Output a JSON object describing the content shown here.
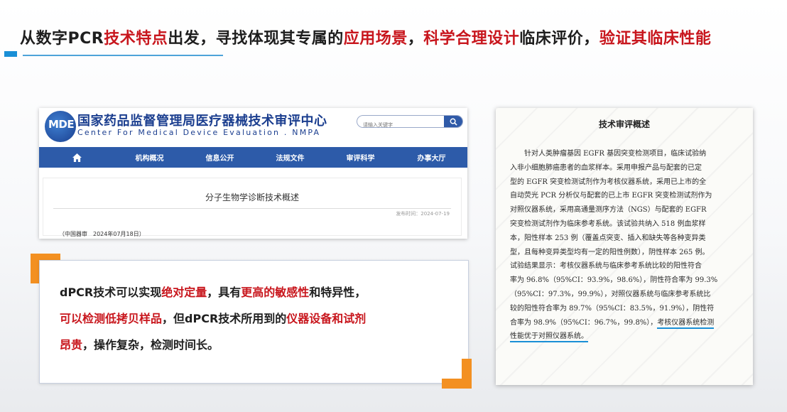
{
  "headline": {
    "segments": [
      {
        "text": "从数字PCR",
        "emph": false
      },
      {
        "text": "技术特点",
        "emph": true
      },
      {
        "text": "出发，寻找体现其专属的",
        "emph": false
      },
      {
        "text": "应用场景",
        "emph": true
      },
      {
        "text": "，",
        "emph": false
      },
      {
        "text": "科学合理设计",
        "emph": true
      },
      {
        "text": "临床评价，",
        "emph": false
      },
      {
        "text": "验证其临床性能",
        "emph": true
      }
    ]
  },
  "nmpa_site": {
    "logo_text": "MDE",
    "title_cn": "国家药品监督管理局医疗器械技术审评中心",
    "title_en": "Center For Medical Device Evaluation . NMPA",
    "search_placeholder": "请输入关键字",
    "nav": {
      "home_icon": "home-icon",
      "items": [
        "机构概况",
        "信息公开",
        "法规文件",
        "审评科学",
        "办事大厅"
      ]
    },
    "article_title": "分子生物学诊断技术概述",
    "publish_date": "发布时间：2024-07-19",
    "source_line": "（中国器审　2024年07月18日）"
  },
  "quote": {
    "lines": [
      [
        {
          "text": "dPCR技术可以实现",
          "emph": false
        },
        {
          "text": "绝对定量",
          "emph": true
        },
        {
          "text": "，具有",
          "emph": false
        },
        {
          "text": "更高的敏感性",
          "emph": true
        },
        {
          "text": "和特异性，",
          "emph": false
        }
      ],
      [
        {
          "text": "可以检测低拷贝样品",
          "emph": true
        },
        {
          "text": "，但dPCR技术所用到的",
          "emph": false
        },
        {
          "text": "仪器设备和试剂",
          "emph": true
        }
      ],
      [
        {
          "text": "昂贵",
          "emph": true
        },
        {
          "text": "，操作复杂，检测时间长。",
          "emph": false
        }
      ]
    ],
    "accent_color": "#f39021"
  },
  "review_doc": {
    "title": "技术审评概述",
    "lines": [
      "针对人类肿瘤基因 EGFR 基因突变检测项目，临床试验纳",
      "入非小细胞肺癌患者的血浆样本。采用申报产品与配套的已定",
      "型的 EGFR 突变检测试剂作为考核仪器系统，采用已上市的全",
      "自动荧光 PCR 分析仪与配套的已上市 EGFR 突变检测试剂作为",
      "对照仪器系统，采用高通量测序方法（NGS）与配套的 EGFR",
      "突变检测试剂作为临床参考系统。该试验共纳入 518 例血浆样",
      "本，阳性样本 253 例（覆盖点突变、插入和缺失等各种变异类",
      "型，且每种变异类型均有一定的阳性例数），阴性样本 265 例。",
      "试验结果显示：考核仪器系统与临床参考系统比较的阳性符合",
      "率为 96.8%（95%CI：93.9%，98.6%），阴性符合率为 99.3%",
      "（95%CI：97.3%，99.9%），对照仪器系统与临床参考系统比",
      "较的阳性符合率为 89.7%（95%CI：83.5%，91.9%），阴性符",
      "合率为 98.9%（95%CI：96.7%，99.8%），"
    ],
    "highlight_tail": "考核仪器系统检测",
    "highlight_line": "性能优于对照仪器系统。",
    "highlight_color": "#1a8fd6"
  },
  "colors": {
    "emphasis_red": "#c8161d",
    "nav_blue": "#2d5ba9",
    "accent_blue": "#1a8fd6"
  }
}
